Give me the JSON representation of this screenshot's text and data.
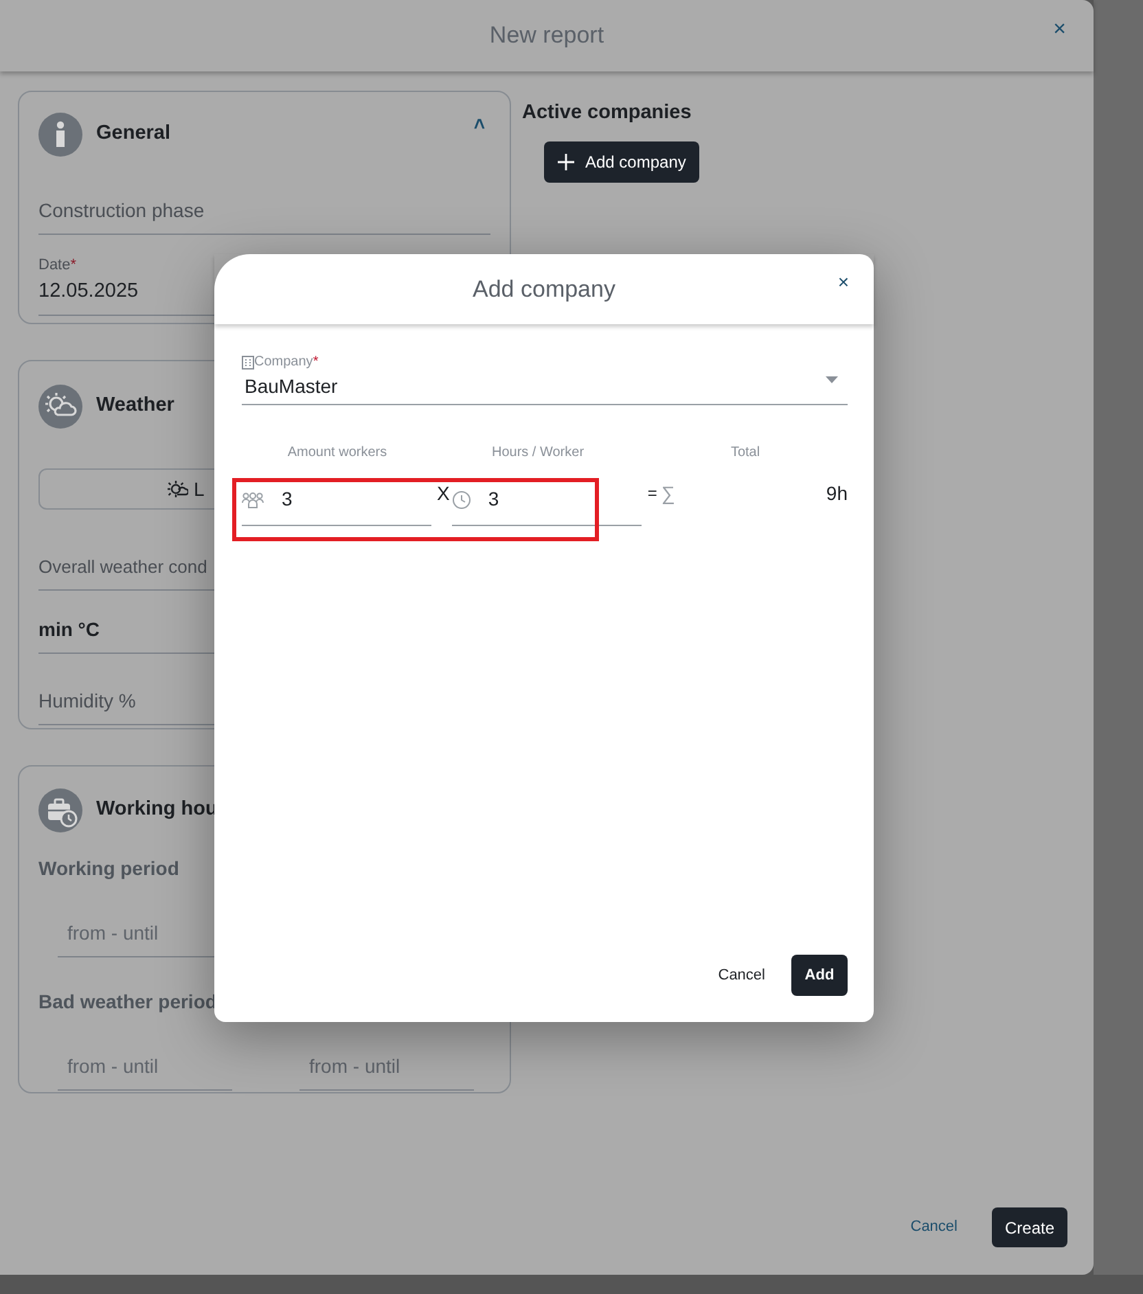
{
  "report": {
    "title": "New report",
    "close": "×",
    "general": {
      "title": "General",
      "expanded": true,
      "caret": "˄",
      "construction_phase": {
        "placeholder": "Construction phase"
      },
      "date": {
        "label": "Date",
        "required_mark": "*",
        "value": "12.05.2025"
      }
    },
    "weather": {
      "title": "Weather",
      "load_button": "L",
      "fields": [
        {
          "placeholder": "Overall weather cond"
        },
        {
          "placeholder": "min °C"
        },
        {
          "placeholder": "Humidity %"
        }
      ]
    },
    "working_hours": {
      "title": "Working hou",
      "periods": [
        {
          "label": "Working period",
          "fields": [
            {
              "placeholder": "from - until"
            }
          ]
        },
        {
          "label": "Bad weather period",
          "fields": [
            {
              "placeholder": "from - until"
            },
            {
              "placeholder": "from - until"
            }
          ]
        }
      ]
    },
    "active_companies": {
      "title": "Active companies",
      "add_button": "Add company"
    },
    "cancel": "Cancel",
    "create": "Create"
  },
  "dialog": {
    "title": "Add company",
    "close": "×",
    "company": {
      "label": "Company",
      "required_mark": "*",
      "value": "BauMaster"
    },
    "columns": [
      "Amount workers",
      "Hours / Worker",
      "Total"
    ],
    "workers": "3",
    "times": "X",
    "hours": "3",
    "equals": "=",
    "sigma": "∑",
    "total": "9h",
    "highlighted": true,
    "cancel": "Cancel",
    "add": "Add"
  }
}
